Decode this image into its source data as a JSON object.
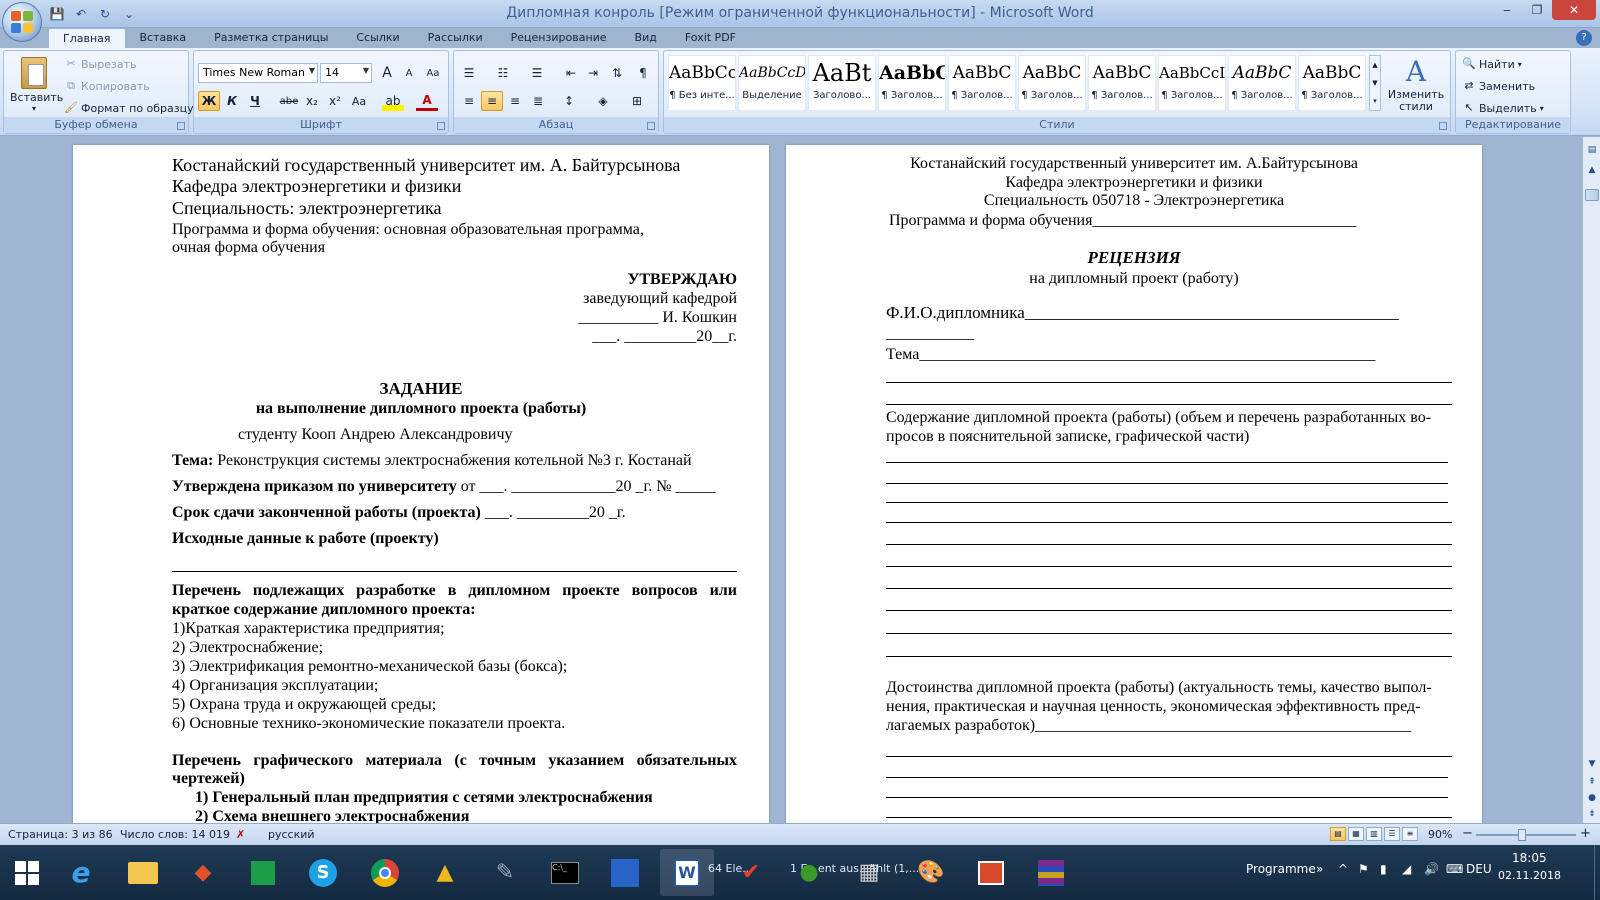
{
  "window": {
    "title": "Дипломная конроль [Режим ограниченной функциональности] - Microsoft Word",
    "minimize": "‒",
    "restore": "❐",
    "close": "✕"
  },
  "qat": {
    "save": "💾",
    "undo": "↶",
    "redo": "↻",
    "more": "⌄"
  },
  "tabs": [
    "Главная",
    "Вставка",
    "Разметка страницы",
    "Ссылки",
    "Рассылки",
    "Рецензирование",
    "Вид",
    "Foxit PDF"
  ],
  "help": "?",
  "ribbon": {
    "clipboard": {
      "label": "Буфер обмена",
      "paste": "Вставить",
      "cut": "Вырезать",
      "copy": "Копировать",
      "format_painter": "Формат по образцу"
    },
    "font": {
      "label": "Шрифт",
      "name": "Times New Roman",
      "size": "14",
      "grow": "A",
      "shrink": "A",
      "clear": "Aa",
      "bold": "Ж",
      "italic": "К",
      "underline": "Ч",
      "strike": "abe",
      "sub": "x₂",
      "sup": "x²",
      "case": "Aa",
      "highlight": "ab",
      "color": "A"
    },
    "paragraph": {
      "label": "Абзац"
    },
    "styles": {
      "label": "Стили",
      "items": [
        {
          "sample": "AaBbCcI",
          "name": "¶ Без инте..."
        },
        {
          "sample": "AaBbCcDc",
          "name": "Выделение"
        },
        {
          "sample": "AaBt",
          "name": "Заголово..."
        },
        {
          "sample": "AaBbC",
          "name": "¶ Заголов..."
        },
        {
          "sample": "AaBbC",
          "name": "¶ Заголов..."
        },
        {
          "sample": "AaBbC",
          "name": "¶ Заголов..."
        },
        {
          "sample": "AaBbC",
          "name": "¶ Заголов..."
        },
        {
          "sample": "AaBbCcI",
          "name": "¶ Заголов..."
        },
        {
          "sample": "AaBbC",
          "name": "¶ Заголов..."
        },
        {
          "sample": "AaBbC",
          "name": "¶ Заголов..."
        }
      ],
      "change": "Изменить стили"
    },
    "editing": {
      "label": "Редактирование",
      "find": "Найти",
      "replace": "Заменить",
      "select": "Выделить"
    }
  },
  "left_page": {
    "l1": "Костанайский государственный университет им. А. Байтурсынова",
    "l2": "Кафедра электроэнергетики и физики",
    "l3": "Специальность: электроэнергетика",
    "l4": "Программа и форма обучения: основная образовательная программа,",
    "l5": "очная форма обучения",
    "approve": "УТВЕРЖДАЮ",
    "head": "заведующий кафедрой",
    "sign": "__________ И. Кошкин",
    "date": "___. _________20__г.",
    "task": "ЗАДАНИЕ",
    "task_sub": "на выполнение дипломного проекта (работы)",
    "student": "студенту Кооп Андрею Александровичу",
    "theme_label": "Тема:",
    "theme": "Реконструкция системы электроснабжения котельной №3 г. Костанай",
    "order_label": "Утверждена приказом по университету",
    "order": "от ___. _____________20 _г. № _____",
    "deadline_label": "Срок сдачи законченной работы (проекта)",
    "deadline": "___. _________20 _г.",
    "initial": "Исходные данные к работе (проекту)",
    "list_h1": "Перечень подлежащих разработке в дипломном проекте вопросов или",
    "list_h2": "краткое содержание дипломного проекта:",
    "items": [
      "1)Краткая характеристика предприятия;",
      "2) Электроснабжение;",
      "3) Электрификация  ремонтно-механической базы (бокса);",
      "4) Организация эксплуатации;",
      "5) Охрана труда и окружающей среды;",
      "6) Основные технико-экономические показатели проекта."
    ],
    "graph_h1": "Перечень графического материала (с точным указанием обязательных",
    "graph_h2": "чертежей)",
    "g1": "1)  Генеральный план предприятия с сетями электроснабжения",
    "g2": "2)  Схема внешнего электроснабжения"
  },
  "right_page": {
    "l1": "Костанайский государственный университет им. А.Байтурсынова",
    "l2": "Кафедра электроэнергетики и физики",
    "l3": "Специальность    050718 - Электроэнергетика",
    "l4": "Программа и форма обучения_________________________________",
    "title": "РЕЦЕНЗИЯ",
    "subtitle": "на дипломный проект (работу)",
    "fio": "Ф.И.О.дипломника____________________________________________",
    "fio2": "___________",
    "tema": "Тема_________________________________________________________",
    "content1": "Содержание дипломной проекта (работы) (объем и перечень разработанных во-",
    "content2": "просов в пояснительной записке, графической части)",
    "merits1": "Достоинства дипломной проекта (работы) (актуальность темы, качество выпол-",
    "merits2": "нения, практическая и научная ценность, экономическая эффективность пред-",
    "merits3": "лагаемых разработок)_______________________________________________"
  },
  "status": {
    "page": "Страница: 3 из 86",
    "words": "Число слов: 14 019",
    "lang": "русский",
    "zoom": "90%",
    "zoom_minus": "−",
    "zoom_plus": "+"
  },
  "taskbar": {
    "label1": "64 Ele...",
    "label2": "1 E...ent aus...ählt (1,...",
    "programme": "Programme",
    "lang": "DEU",
    "time": "18:05",
    "date": "02.11.2018"
  }
}
